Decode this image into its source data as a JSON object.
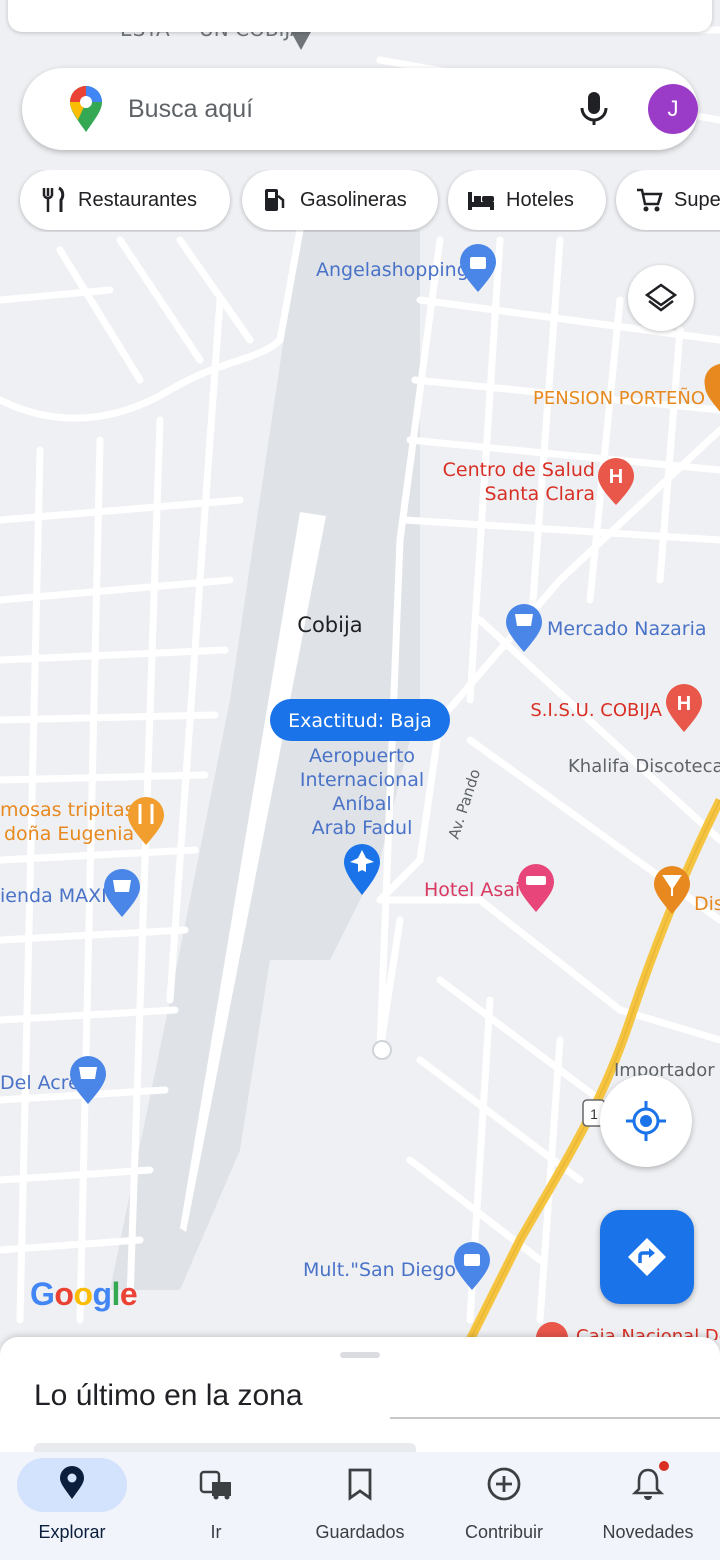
{
  "search": {
    "placeholder": "Busca aquí",
    "avatar_letter": "J"
  },
  "chips": [
    {
      "label": "Restaurantes",
      "icon": "fork-knife-icon"
    },
    {
      "label": "Gasolineras",
      "icon": "gas-station-icon"
    },
    {
      "label": "Hoteles",
      "icon": "bed-icon"
    },
    {
      "label": "Supe",
      "icon": "cart-icon"
    }
  ],
  "map": {
    "top_partial_label": "ESTA ~ UN COBIJA",
    "city": "Cobija",
    "accuracy": "Exactitud: Baja",
    "street": "Av. Pando",
    "route_shield": "1",
    "pois": {
      "angelashopping": "Angelashopping",
      "pension": "PENSION PORTEÑO",
      "centro_1": "Centro de Salud",
      "centro_2": "Santa Clara",
      "mercado": "Mercado Nazaria",
      "sisu": "S.I.S.U. COBIJA",
      "khalifa": "Khalifa Discoteca",
      "airport_1": "Aeropuerto",
      "airport_2": "Internacional",
      "airport_3": "Aníbal",
      "airport_4": "Arab Fadul",
      "tripitas_1": "mosas tripitas",
      "tripitas_2": "doña Eugenia",
      "tienda": "ienda MAXI",
      "hotel": "Hotel Asai",
      "disco": "Dis",
      "importadora": "Importador",
      "del_acre": "Del Acre",
      "san_diego": "Mult.\"San Diego\"",
      "bottom_partial": "Caja Nacional De"
    }
  },
  "google_logo": "Google",
  "sheet": {
    "title": "Lo último en la zona"
  },
  "nav": [
    {
      "label": "Explorar",
      "icon": "location-pin-icon",
      "active": true
    },
    {
      "label": "Ir",
      "icon": "commute-icon"
    },
    {
      "label": "Guardados",
      "icon": "bookmark-icon"
    },
    {
      "label": "Contribuir",
      "icon": "add-circle-icon"
    },
    {
      "label": "Novedades",
      "icon": "bell-icon",
      "badge": true
    }
  ],
  "colors": {
    "map_bg": "#eef0f3",
    "road": "#ffffff",
    "airport": "#dfe2e7",
    "highway": "#f5c542",
    "poi_orange": "#e8891f",
    "poi_red": "#d93025",
    "poi_blue": "#1a73e8",
    "poi_pink": "#e8457a",
    "accent": "#1a73e8"
  }
}
